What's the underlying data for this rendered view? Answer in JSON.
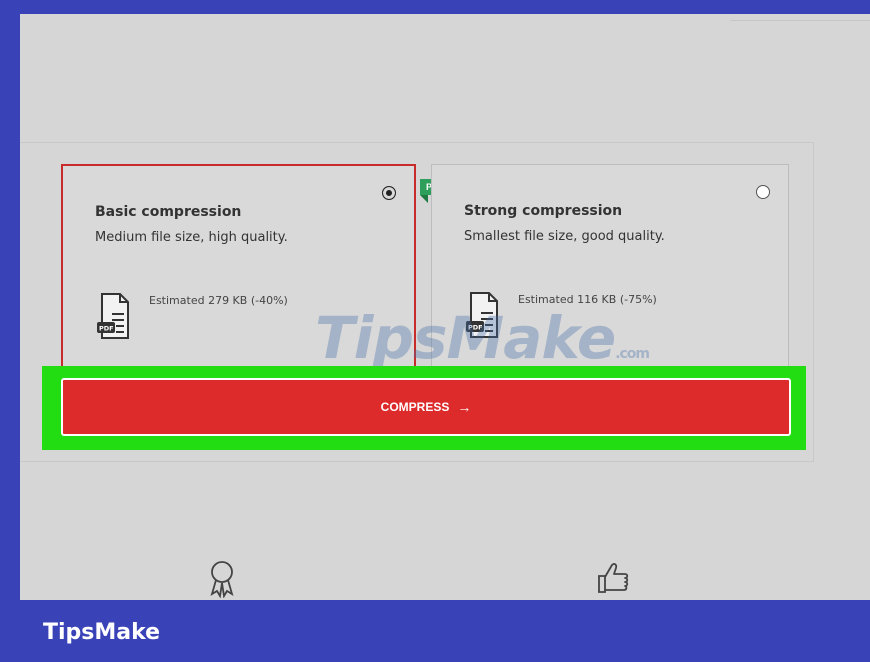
{
  "options": [
    {
      "title": "Basic compression",
      "description": "Medium file size, high quality.",
      "estimate": "Estimated 279 KB (-40%)",
      "selected": true
    },
    {
      "title": "Strong compression",
      "description": "Smallest file size, good quality.",
      "estimate": "Estimated 116 KB (-75%)",
      "selected": false,
      "badge": "PRO"
    }
  ],
  "compress_button": {
    "label": "COMPRESS",
    "arrow": "→"
  },
  "footer_icons": [
    "award-icon",
    "thumbs-up-icon"
  ],
  "watermark": {
    "main": "TipsMake",
    "suffix": ".com"
  },
  "brand": "TipsMake",
  "colors": {
    "accent_red": "#dd2b2b",
    "highlight_green": "#22dd11",
    "pro_badge": "#2e9e5b",
    "frame_blue": "#3a42b8"
  }
}
